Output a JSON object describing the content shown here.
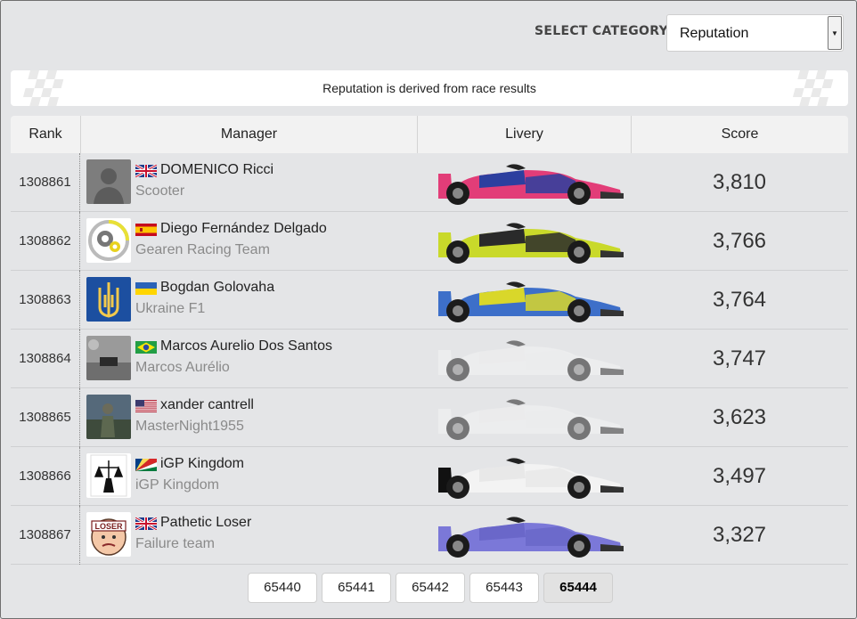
{
  "header": {
    "category_label": "SELECT CATEGORY",
    "category_selected": "Reputation"
  },
  "banner": {
    "text": "Reputation is derived from race results"
  },
  "table": {
    "columns": [
      "Rank",
      "Manager",
      "Livery",
      "Score"
    ],
    "rows": [
      {
        "rank": "1308861",
        "name": "DOMENICO Ricci",
        "team": "Scooter",
        "score": "3,810",
        "flag": "uk-flag",
        "avatar": "default-avatar",
        "livery": "livery-pink-blue"
      },
      {
        "rank": "1308862",
        "name": "Diego Fernández Delgado",
        "team": "Gearen Racing Team",
        "score": "3,766",
        "flag": "spain-flag",
        "avatar": "gear-logo-avatar",
        "livery": "livery-yellow-black"
      },
      {
        "rank": "1308863",
        "name": "Bogdan Golovaha",
        "team": "Ukraine F1",
        "score": "3,764",
        "flag": "ukraine-flag",
        "avatar": "trident-avatar",
        "livery": "livery-blue-yellow"
      },
      {
        "rank": "1308864",
        "name": "Marcos Aurelio Dos Santos",
        "team": "Marcos Aurélio",
        "score": "3,747",
        "flag": "brazil-flag",
        "avatar": "photo-avatar",
        "livery": "livery-faded"
      },
      {
        "rank": "1308865",
        "name": "xander cantrell",
        "team": "MasterNight1955",
        "score": "3,623",
        "flag": "usa-flag",
        "avatar": "soldier-avatar",
        "livery": "livery-faded"
      },
      {
        "rank": "1308866",
        "name": "iGP Kingdom",
        "team": "iGP Kingdom",
        "score": "3,497",
        "flag": "seychelles-flag",
        "avatar": "justice-avatar",
        "livery": "livery-white"
      },
      {
        "rank": "1308867",
        "name": "Pathetic Loser",
        "team": "Failure team",
        "score": "3,327",
        "flag": "uk-flag",
        "avatar": "loser-avatar",
        "livery": "livery-lavender"
      }
    ]
  },
  "pagination": {
    "pages": [
      "65440",
      "65441",
      "65442",
      "65443",
      "65444"
    ],
    "active": "65444"
  },
  "colors": {
    "background": "#e4e5e7",
    "header_row": "#f2f2f2",
    "muted_text": "#8a8a8a"
  }
}
